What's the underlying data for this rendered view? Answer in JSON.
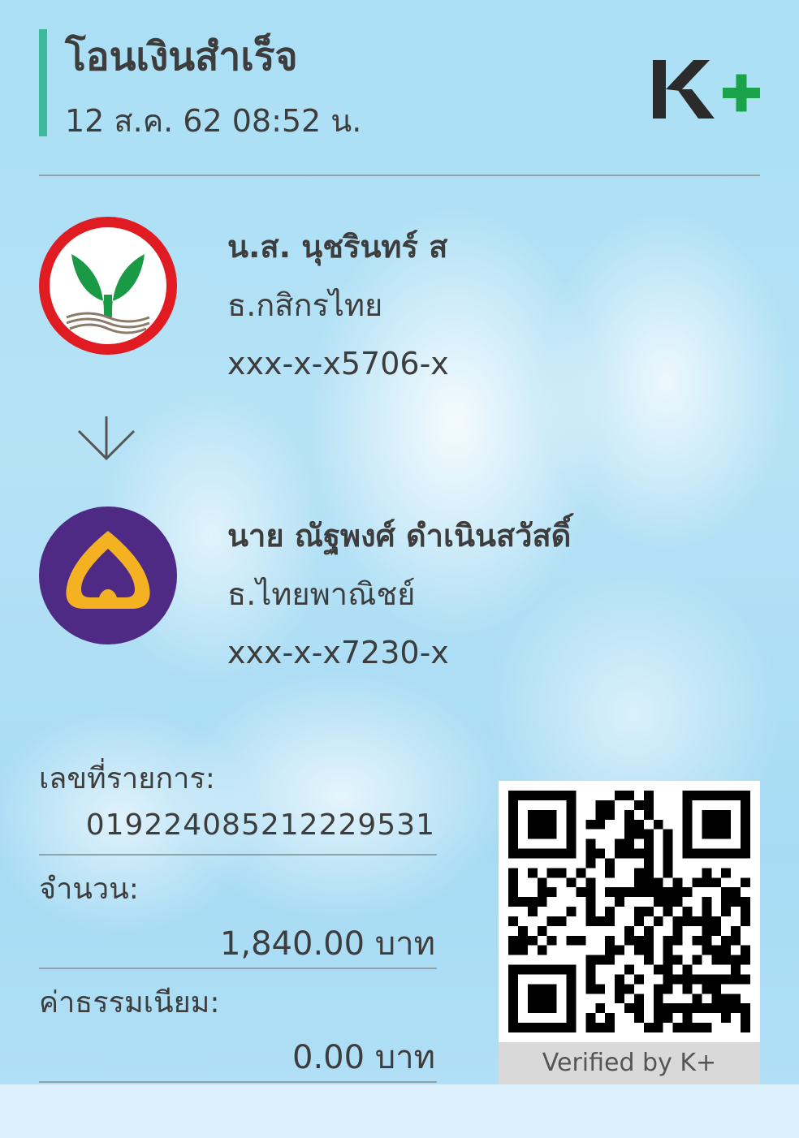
{
  "header": {
    "title": "โอนเงินสำเร็จ",
    "datetime": "12 ส.ค. 62  08:52 น.",
    "brand": "K+"
  },
  "sender": {
    "name": "น.ส. นุชรินทร์ ส",
    "bank": "ธ.กสิกรไทย",
    "account": "xxx-x-x5706-x",
    "logo_icon": "kasikorn-bank-logo-icon"
  },
  "receiver": {
    "name": "นาย ณัฐพงศ์ ดำเนินสวัสดิ์",
    "bank": "ธ.ไทยพาณิชย์",
    "account": "xxx-x-x7230-x",
    "logo_icon": "scb-bank-logo-icon"
  },
  "transaction": {
    "ref_label": "เลขที่รายการ:",
    "ref_value": "019224085212229531",
    "amount_label": "จำนวน:",
    "amount_value": "1,840.00 บาท",
    "fee_label": "ค่าธรรมเนียม:",
    "fee_value": "0.00 บาท"
  },
  "qr": {
    "verified_text": "Verified by K+"
  },
  "colors": {
    "accent": "#3db89a",
    "kplus_green": "#1aa34a",
    "kbank_red": "#e01b22",
    "scb_purple": "#4e2a84",
    "scb_gold": "#f4b223"
  }
}
